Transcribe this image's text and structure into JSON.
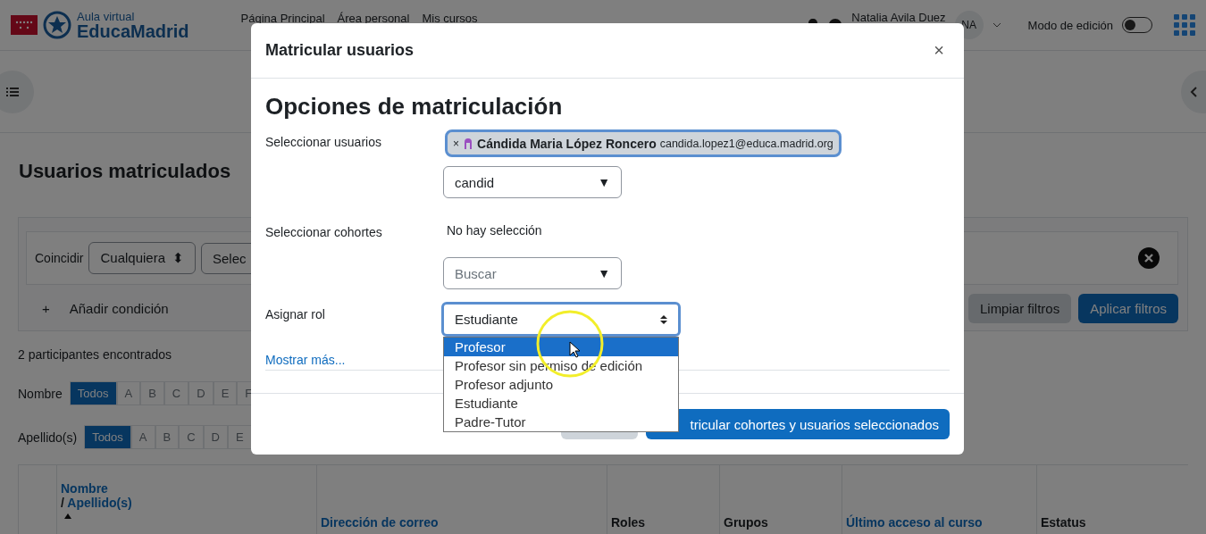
{
  "header": {
    "logo_line1": "Aula virtual",
    "logo_line2": "EducaMadrid",
    "nav": [
      "Página Principal",
      "Área personal",
      "Mis cursos"
    ],
    "user_name": "Natalia Avila Duez",
    "avatar": "NA",
    "edit_mode": {
      "label": "Modo de edición",
      "on": false
    }
  },
  "page": {
    "title": "Usuarios matriculados",
    "filter": {
      "match_label": "Coincidir",
      "match_value": "Cualquiera",
      "match_arrows": "⬍",
      "select_2": "Selec",
      "add_icon": "+",
      "add_condition": "Añadir condición",
      "clear": "Limpiar filtros",
      "apply": "Aplicar filtros"
    },
    "count": "2 participantes encontrados",
    "letter_bars": [
      {
        "label": "Nombre",
        "letters": [
          {
            "text": "Todos",
            "selected": true
          },
          {
            "text": "A",
            "selected": false
          },
          {
            "text": "B",
            "selected": false
          },
          {
            "text": "C",
            "selected": false
          },
          {
            "text": "D",
            "selected": false
          },
          {
            "text": "E",
            "selected": false
          },
          {
            "text": "F",
            "selected": false
          }
        ]
      },
      {
        "label": "Apellido(s)",
        "letters": [
          {
            "text": "Todos",
            "selected": true
          },
          {
            "text": "A",
            "selected": false
          },
          {
            "text": "B",
            "selected": false
          },
          {
            "text": "C",
            "selected": false
          },
          {
            "text": "D",
            "selected": false
          },
          {
            "text": "E",
            "selected": false
          }
        ]
      }
    ],
    "table": {
      "columns": [
        {
          "label": "Nombre",
          "separator": "/",
          "label_2": "Apellido(s)",
          "link": true,
          "sort_ascending": true
        },
        {
          "label": "Dirección de correo",
          "link": true
        },
        {
          "label": "Roles",
          "link": false
        },
        {
          "label": "Grupos",
          "link": false
        },
        {
          "label": "Último acceso al curso",
          "link": true
        },
        {
          "label": "Estatus",
          "link": false
        }
      ]
    }
  },
  "modal": {
    "title": "Matricular usuarios",
    "close": "×",
    "heading": "Opciones de matriculación",
    "users": {
      "label": "Seleccionar usuarios",
      "selected": [
        {
          "remove": "×",
          "name": "Cándida Maria López Roncero",
          "email": "candida.lopez1@educa.madrid.org"
        }
      ],
      "search_value": "candid",
      "caret": "▼"
    },
    "cohorts": {
      "label": "Seleccionar cohortes",
      "empty": "No hay selección",
      "placeholder": "Buscar",
      "caret": "▼"
    },
    "role": {
      "label": "Asignar rol",
      "value": "Estudiante",
      "options": [
        {
          "text": "Profesor",
          "highlighted": true
        },
        {
          "text": "Profesor sin permiso de edición",
          "highlighted": false
        },
        {
          "text": "Profesor adjunto",
          "highlighted": false
        },
        {
          "text": "Estudiante",
          "highlighted": false
        },
        {
          "text": "Padre-Tutor",
          "highlighted": false
        }
      ]
    },
    "show_more": "Mostrar más...",
    "submit": "tricular cohortes y usuarios seleccionados"
  }
}
